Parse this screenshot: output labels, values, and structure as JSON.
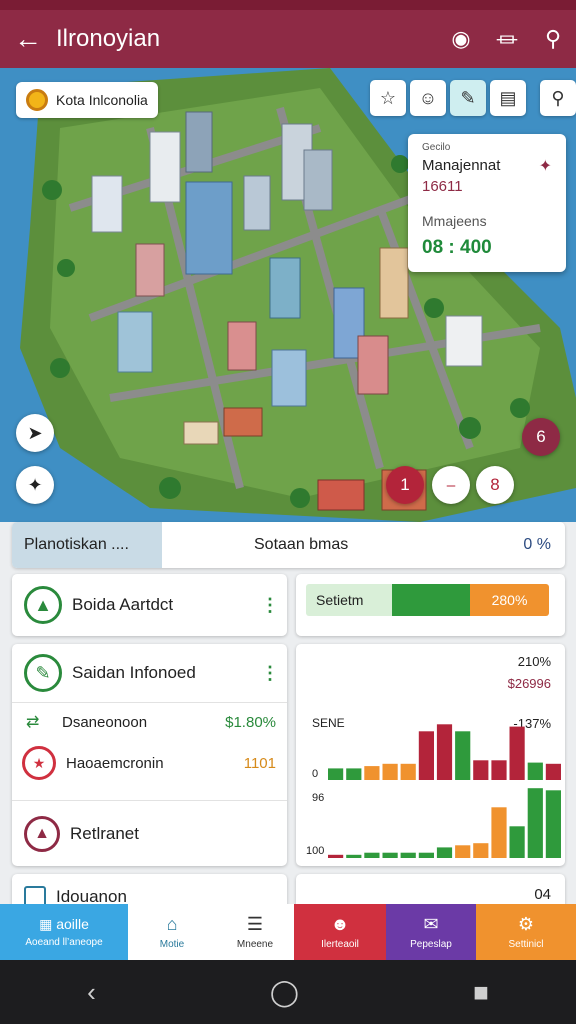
{
  "app_bar": {
    "title": "Ilronoyian",
    "back_icon": "arrow-left-icon",
    "actions": [
      "shield-icon",
      "clip-icon",
      "search-icon"
    ]
  },
  "map": {
    "place_chip": "Kota Inlconolia",
    "tools": [
      "star-icon",
      "smiley-icon",
      "brush-icon",
      "bus-icon",
      "map-pin-icon"
    ],
    "info_card": {
      "kicker": "Gecilo",
      "title1": "Manajennat",
      "value1": "16611",
      "title2": "Mmajeens",
      "value2": "08 : 400"
    },
    "fab_left": [
      "compass-icon",
      "satellite-icon"
    ],
    "pins": [
      {
        "label": "1",
        "color": "#b3243a"
      },
      {
        "label": "⎯",
        "color": "#ffffff"
      },
      {
        "label": "8",
        "color": "#ffffff"
      },
      {
        "label": "6",
        "color": "#8e2a45"
      }
    ]
  },
  "progress": {
    "label_left": "Planotiskan ....",
    "label_mid": "Sotaan bmas",
    "value": "0 %"
  },
  "cards": {
    "c1": {
      "title": "Boida Aartdct",
      "split_label": "Setietm",
      "split_value": "280%"
    },
    "c2": {
      "title": "Saidan Infonoed",
      "rows": [
        {
          "label": "Dsaneonoon",
          "value": "$1.80%"
        },
        {
          "label": "Haoaemcronin",
          "value": "1101"
        }
      ],
      "footer": "Retlranet"
    },
    "chart": {
      "top_values": [
        "210%",
        "$26996"
      ],
      "series_label": "SENE",
      "delta": "-137%",
      "axis_top": "0",
      "axis_mid": "96",
      "axis_bottom": "100"
    },
    "c3": {
      "title": "Idouanon",
      "value": "04"
    }
  },
  "chart_data": [
    {
      "type": "bar",
      "categories": [
        "1",
        "2",
        "3",
        "4",
        "5",
        "6",
        "7",
        "8",
        "9",
        "10",
        "11",
        "12",
        "13"
      ],
      "values": [
        10,
        10,
        12,
        14,
        14,
        42,
        48,
        42,
        17,
        17,
        46,
        15,
        14
      ],
      "colors": [
        "#2f9a3c",
        "#2f9a3c",
        "#f0922e",
        "#f0922e",
        "#f0922e",
        "#b3243a",
        "#b3243a",
        "#2f9a3c",
        "#b3243a",
        "#b3243a",
        "#b3243a",
        "#2f9a3c",
        "#b3243a"
      ]
    },
    {
      "type": "bar",
      "categories": [
        "1",
        "2",
        "3",
        "4",
        "5",
        "6",
        "7",
        "8",
        "9",
        "10",
        "11",
        "12",
        "13"
      ],
      "values": [
        3,
        3,
        5,
        5,
        5,
        5,
        10,
        12,
        14,
        48,
        30,
        66,
        64
      ],
      "colors": [
        "#b3243a",
        "#2f9a3c",
        "#2f9a3c",
        "#2f9a3c",
        "#2f9a3c",
        "#2f9a3c",
        "#2f9a3c",
        "#f0922e",
        "#f0922e",
        "#f0922e",
        "#2f9a3c",
        "#2f9a3c",
        "#2f9a3c"
      ]
    }
  ],
  "bottom_nav": [
    {
      "icon": "grid-icon",
      "label": "Aoeand ll’aneope",
      "sub": "aoille",
      "color": "#3aa7e3",
      "text": "#fff"
    },
    {
      "icon": "home-icon",
      "label": "Motie",
      "color": "#ffffff",
      "text": "#2a7a9c"
    },
    {
      "icon": "list-icon",
      "label": "Mneene",
      "color": "#ffffff",
      "text": "#333"
    },
    {
      "icon": "people-icon",
      "label": "Ilerteaoil",
      "color": "#d0303f",
      "text": "#fff"
    },
    {
      "icon": "send-icon",
      "label": "Pepeslap",
      "color": "#6b3aa6",
      "text": "#fff"
    },
    {
      "icon": "gear-icon",
      "label": "Settinicl",
      "color": "#f0922e",
      "text": "#fff"
    }
  ]
}
